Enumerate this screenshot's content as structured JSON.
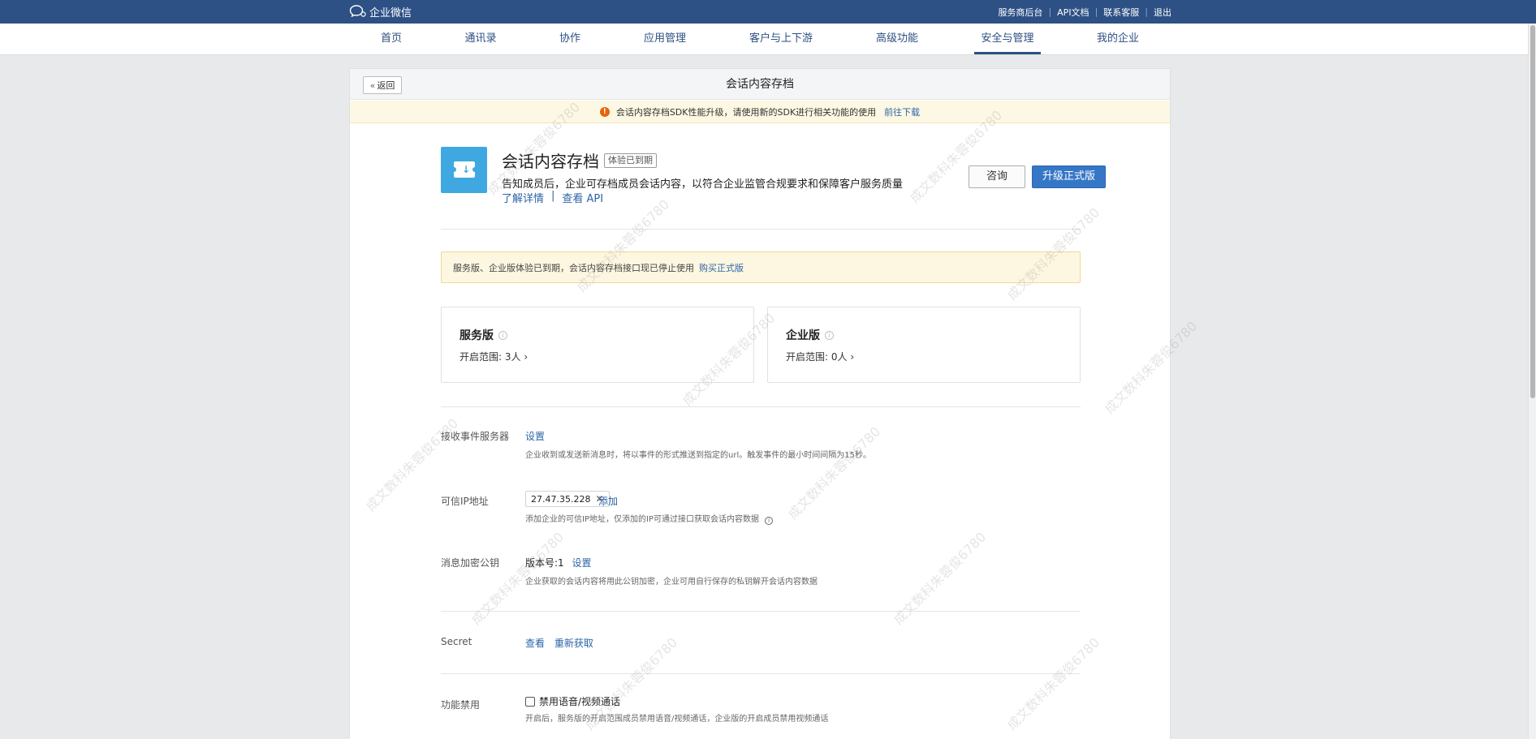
{
  "topbar": {
    "brand": "企业微信",
    "links": [
      "服务商后台",
      "API文档",
      "联系客服",
      "退出"
    ]
  },
  "nav": {
    "items": [
      "首页",
      "通讯录",
      "协作",
      "应用管理",
      "客户与上下游",
      "高级功能",
      "安全与管理",
      "我的企业"
    ],
    "active_index": 6
  },
  "panel": {
    "back_label": "返回",
    "title": "会话内容存档",
    "notice_text": "会话内容存档SDK性能升级，请使用新的SDK进行相关功能的使用",
    "notice_link": "前往下载"
  },
  "app": {
    "name": "会话内容存档",
    "status_badge": "体验已到期",
    "description": "告知成员后，企业可存档成员会话内容，以符合企业监管合规要求和保障客户服务质量",
    "link_details": "了解详情",
    "link_sep": "|",
    "link_api": "查看 API",
    "consult_label": "咨询",
    "upgrade_label": "升级正式版",
    "icon_color": "#3fa8e0"
  },
  "alert": {
    "text": "服务版、企业版体验已到期，会话内容存档接口现已停止使用",
    "link": "购买正式版"
  },
  "editions": [
    {
      "title": "服务版",
      "range": "开启范围: 3人"
    },
    {
      "title": "企业版",
      "range": "开启范围: 0人"
    }
  ],
  "settings": {
    "event_server": {
      "label": "接收事件服务器",
      "action": "设置",
      "hint": "企业收到或发送新消息时，将以事件的形式推送到指定的url。触发事件的最小时间间隔为15秒。"
    },
    "trusted_ip": {
      "label": "可信IP地址",
      "ip": "27.47.35.228",
      "add": "添加",
      "hint": "添加企业的可信IP地址，仅添加的IP可通过接口获取会话内容数据"
    },
    "public_key": {
      "label": "消息加密公钥",
      "version": "版本号:1",
      "action": "设置",
      "hint": "企业获取的会话内容将用此公钥加密，企业可用自行保存的私钥解开会话内容数据"
    },
    "secret": {
      "label": "Secret",
      "view": "查看",
      "refresh": "重新获取"
    },
    "disable": {
      "label": "功能禁用",
      "checkbox_label": "禁用语音/视频通话",
      "hint": "开启后，服务版的开启范围成员禁用语音/视频通话，企业版的开启成员禁用视频通话"
    }
  },
  "watermark": "成文数科朱蓉俊6780",
  "colors": {
    "topbar": "#2d5085",
    "link": "#2b64a8",
    "primary_button": "#3676c6",
    "warning_icon": "#e8640c"
  }
}
